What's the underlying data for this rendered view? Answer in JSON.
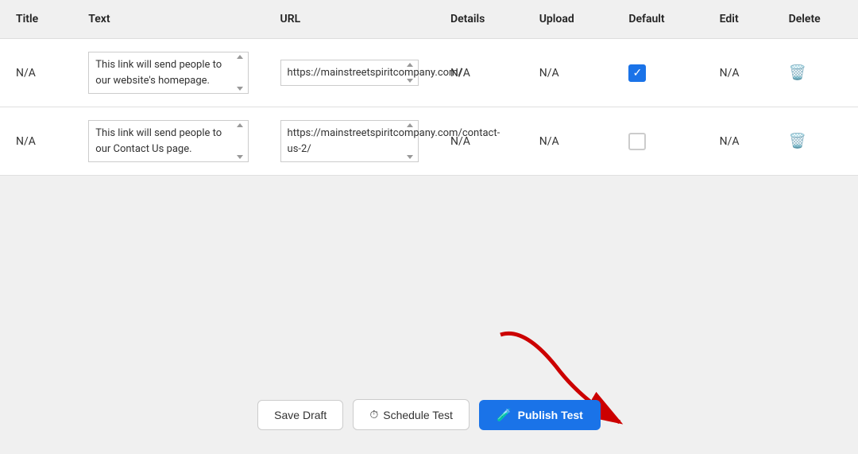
{
  "table": {
    "headers": {
      "title": "Title",
      "text": "Text",
      "url": "URL",
      "details": "Details",
      "upload": "Upload",
      "default": "Default",
      "edit": "Edit",
      "delete": "Delete"
    },
    "rows": [
      {
        "title": "N/A",
        "text": "This link will send people to our website's homepage.",
        "url": "https://mainstreetspiritcompany.com/",
        "details": "N/A",
        "upload": "N/A",
        "default_checked": true,
        "edit": "N/A"
      },
      {
        "title": "N/A",
        "text": "This link will send people to our Contact Us page.",
        "url": "https://mainstreetspiritcompany.com/contact-us-2/",
        "details": "N/A",
        "upload": "N/A",
        "default_checked": false,
        "edit": "N/A"
      }
    ]
  },
  "buttons": {
    "save_draft": "Save Draft",
    "schedule_test": "Schedule Test",
    "publish_test": "Publish Test"
  },
  "icons": {
    "clock": "⏱",
    "flask": "🧪",
    "trash": "🗑",
    "check": "✓"
  }
}
